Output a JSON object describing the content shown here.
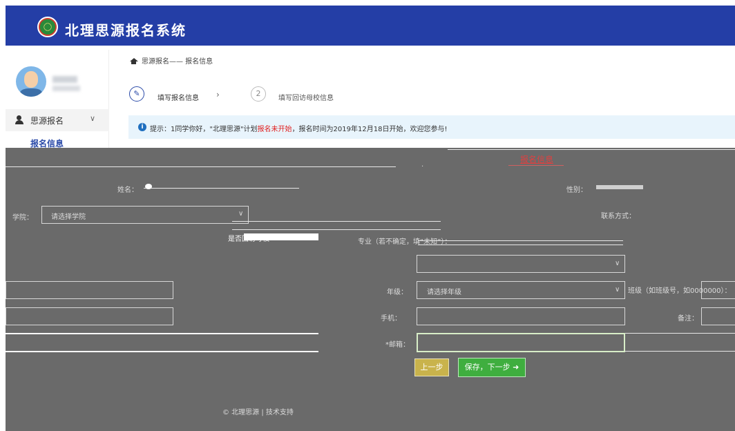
{
  "header": {
    "title": "北理思源报名系统"
  },
  "sidebar": {
    "menu_group": "思源报名",
    "active_item": "报名信息"
  },
  "breadcrumb": "思源报名—— 报名信息",
  "steps": [
    {
      "num": "",
      "label": "填写报名信息"
    },
    {
      "num": "2",
      "label": "填写回访母校信息"
    }
  ],
  "step_sep": "›",
  "notice": {
    "prefix": "提示：1同学你好，\"北理思源\"计划",
    "red": "报名未开始",
    "suffix": "，报名时间为2019年12月18日开始，欢迎您参与!"
  },
  "form": {
    "title": "报名信息",
    "fields": {
      "name_label": "姓名：",
      "gender_label": "性别：",
      "college_label": "学院：",
      "college_select": "请选择学院",
      "major_label": "专业（若不确定，填“未知”）：",
      "grade_label": "年级：",
      "grade_select": "请选择年级",
      "class_label": "班级（如班级号，如0000000）：",
      "phone_label": "手机：",
      "remark_label": "备注：",
      "contact_label": "联系方式：",
      "checkbox_label": "是否回访母校"
    },
    "back_button": "上一步",
    "next_button": "保存，下一步 ➜"
  },
  "footer": "© 北理思源 | 技术支持"
}
